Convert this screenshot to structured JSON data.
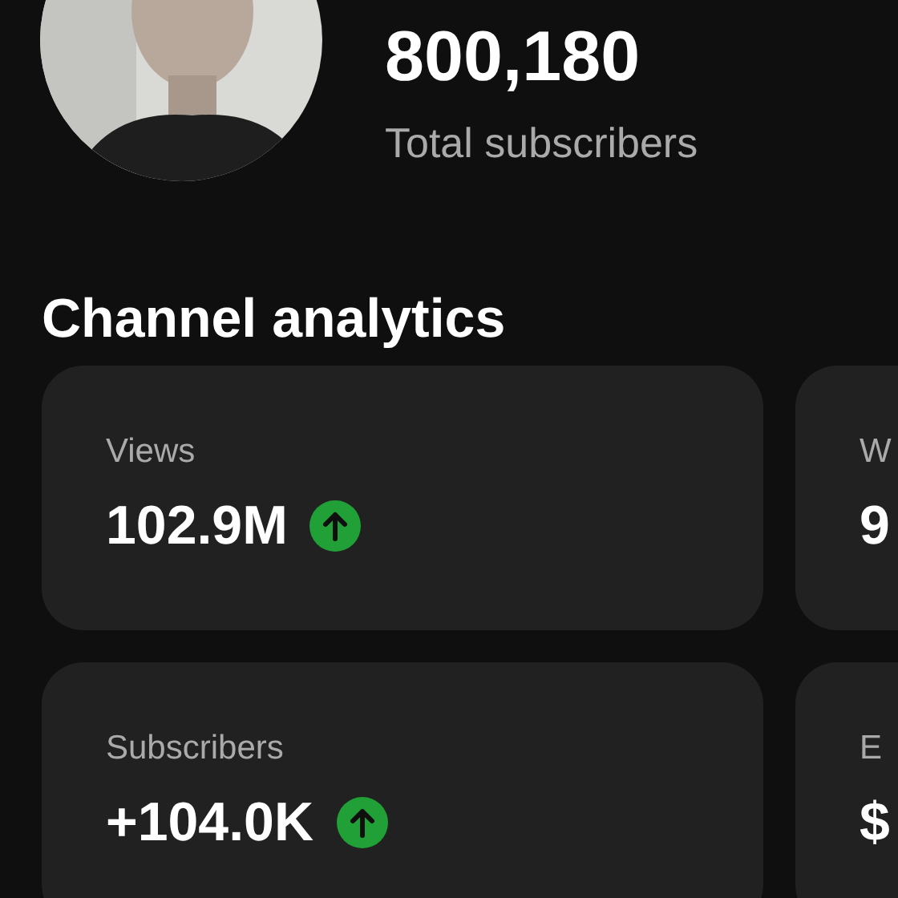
{
  "channel": {
    "subscriber_count": "800,180",
    "subscriber_label": "Total subscribers"
  },
  "section_title": "Channel analytics",
  "metrics": [
    {
      "label": "Views",
      "value": "102.9M",
      "rising": true
    },
    {
      "label": "W",
      "value": "9"
    },
    {
      "label": "Subscribers",
      "value": "+104.0K",
      "rising": true
    },
    {
      "label": "E",
      "value": "$"
    }
  ]
}
